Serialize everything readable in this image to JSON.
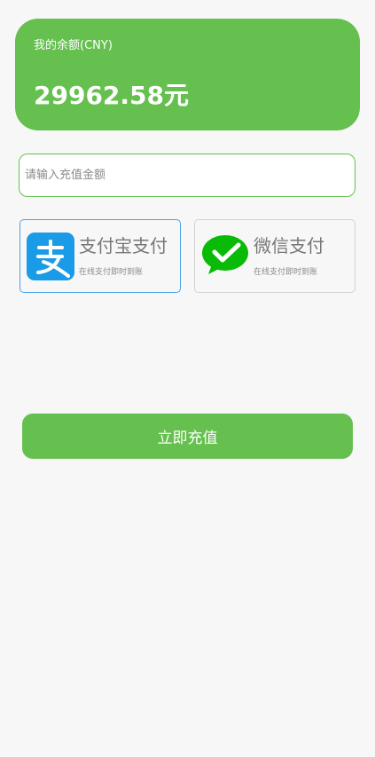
{
  "balance": {
    "label": "我的余额(CNY)",
    "amount": "29962.58元"
  },
  "recharge_input": {
    "placeholder": "请输入充值金额",
    "value": ""
  },
  "payment_methods": [
    {
      "title": "支付宝支付",
      "subtitle": "在线支付即时到账",
      "icon": "alipay-icon",
      "selected": true
    },
    {
      "title": "微信支付",
      "subtitle": "在线支付即时到账",
      "icon": "wechat-pay-icon",
      "selected": false
    }
  ],
  "actions": {
    "recharge_label": "立即充值"
  },
  "colors": {
    "accent": "#65c04f",
    "selected_border": "#4aa0e6",
    "alipay_blue": "#1a9be8",
    "wechat_green": "#09bb07"
  }
}
